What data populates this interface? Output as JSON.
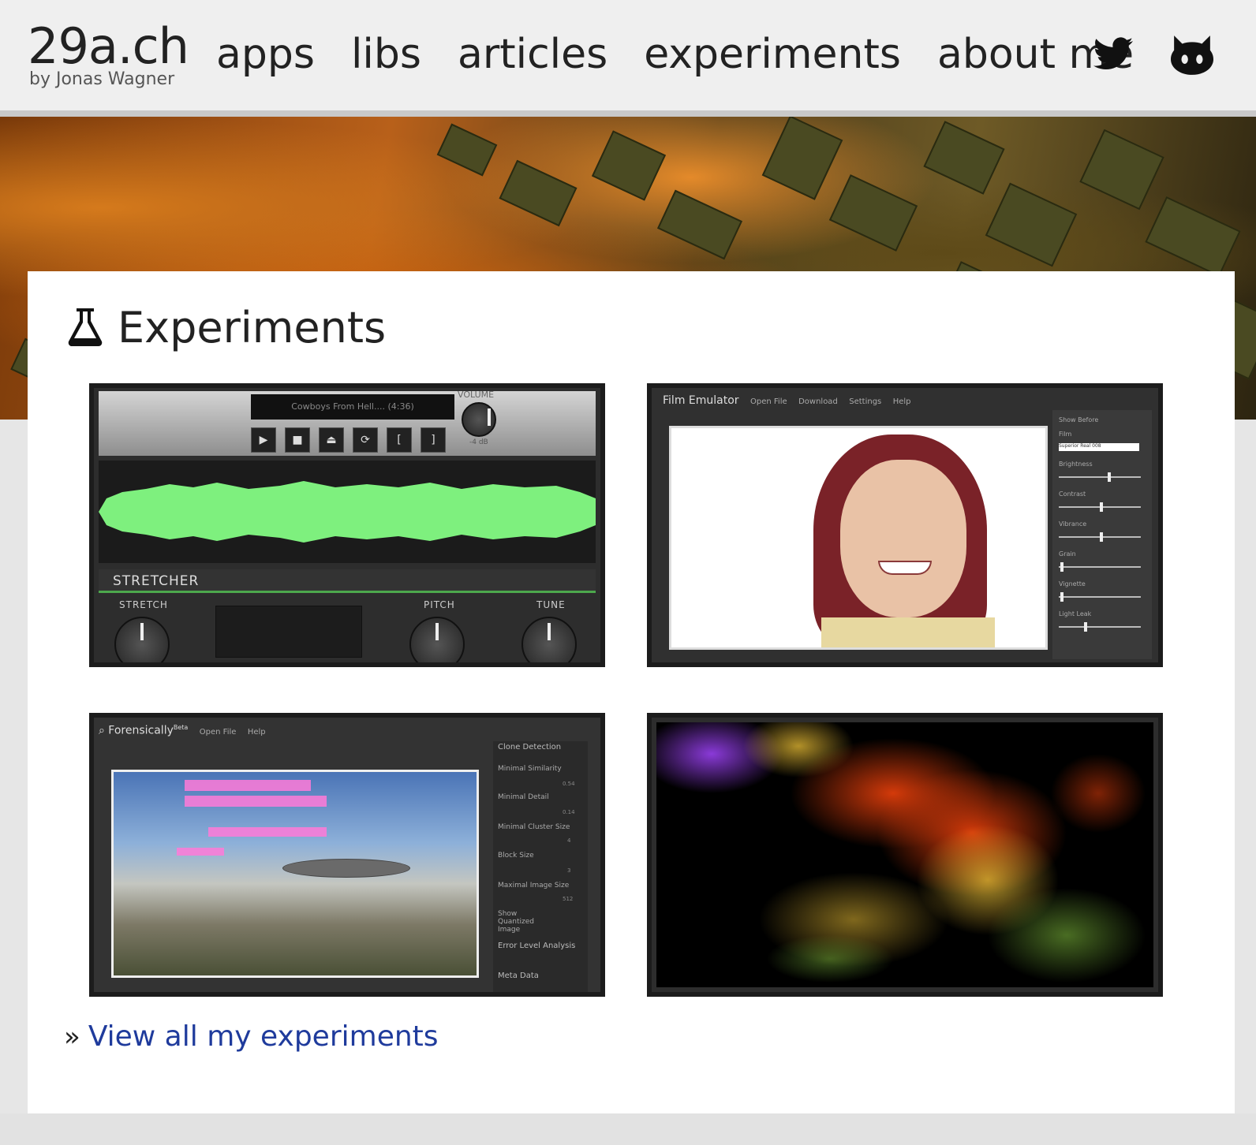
{
  "site": {
    "title": "29a.ch",
    "byline": "by Jonas Wagner"
  },
  "nav": {
    "items": [
      "apps",
      "libs",
      "articles",
      "experiments",
      "about me"
    ],
    "twitter_icon": "twitter-icon",
    "github_icon": "github-icon"
  },
  "section": {
    "title": "Experiments",
    "icon": "flask-icon"
  },
  "experiments": [
    {
      "name": "stretcher",
      "lcd": "Cowboys From Hell....  (4:36)",
      "volume_label": "VOLUME",
      "volume_value": "-4 dB",
      "brand": "STRETCHER",
      "labels": [
        "STRETCH",
        "PITCH",
        "TUNE"
      ]
    },
    {
      "name": "film-emulator",
      "title": "Film Emulator",
      "menu": [
        "Open File",
        "Download",
        "Settings",
        "Help"
      ],
      "side": [
        "Show Before",
        "Film",
        "Brightness",
        "Contrast",
        "Vibrance",
        "Grain",
        "Vignette",
        "Light Leak"
      ],
      "film_value": "Superior Real 008"
    },
    {
      "name": "forensically",
      "title": "Forensically",
      "badge": "Beta",
      "menu": [
        "Open File",
        "Help"
      ],
      "side": [
        "Clone Detection",
        "Minimal Similarity",
        "Minimal Detail",
        "Minimal Cluster Size",
        "Block Size",
        "Maximal Image Size",
        "Show Quantized Image",
        "Error Level Analysis",
        "Meta Data"
      ],
      "values": [
        "0.54",
        "0.14",
        "4",
        "3",
        "512"
      ]
    },
    {
      "name": "fluid-fire"
    }
  ],
  "view_all": {
    "label": "View all my experiments",
    "chevron": "»"
  },
  "colors": {
    "link": "#1f3b9c",
    "header_bg": "#efefef",
    "wave_green": "#7ef07e"
  }
}
